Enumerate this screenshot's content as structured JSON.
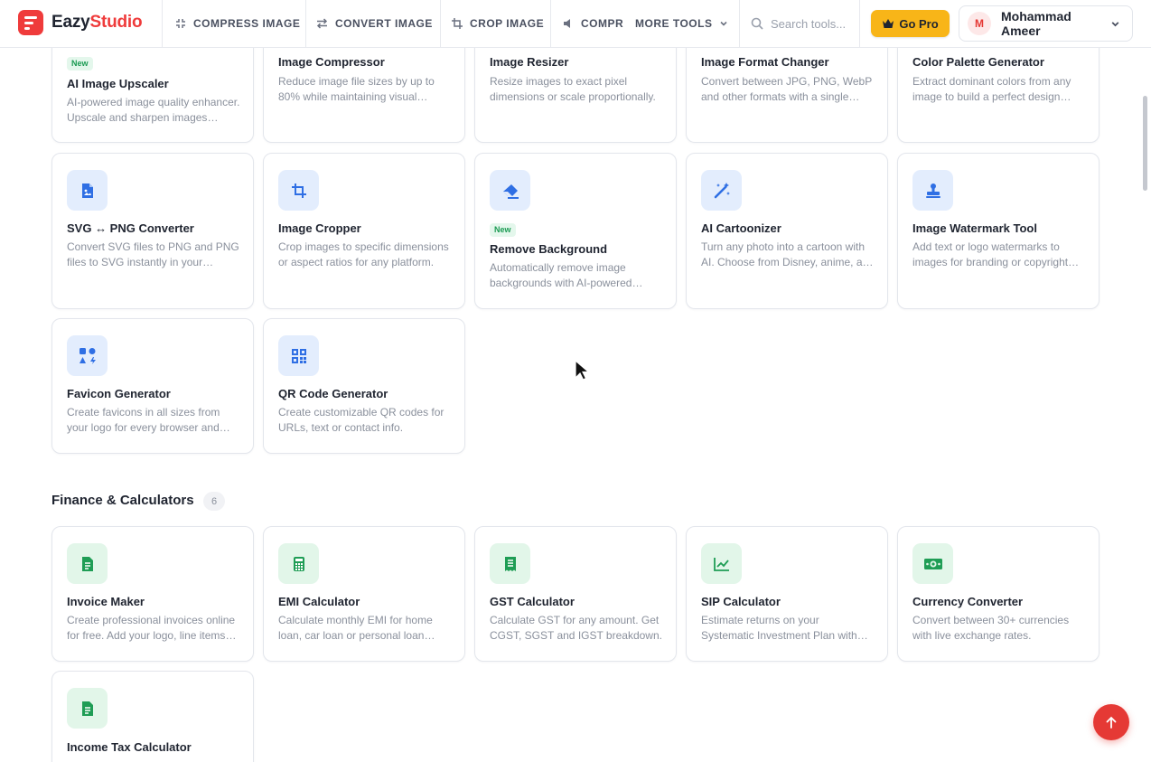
{
  "header": {
    "logo_part1": "Eazy",
    "logo_part2": "Studio",
    "nav": [
      {
        "label": "COMPRESS IMAGE",
        "icon": "compress-icon"
      },
      {
        "label": "CONVERT IMAGE",
        "icon": "convert-arrows-icon"
      },
      {
        "label": "CROP IMAGE",
        "icon": "crop-icon"
      },
      {
        "label": "COMPR",
        "icon": "audio-icon"
      }
    ],
    "more_tools": "MORE TOOLS",
    "search_placeholder": "Search tools...",
    "go_pro": "Go Pro",
    "user_initial": "M",
    "user_name": "Mohammad Ameer"
  },
  "image_tools": [
    {
      "title": "AI Image Upscaler",
      "badge": "New",
      "desc": "AI-powered image quality enhancer. Upscale and sharpen images instantly."
    },
    {
      "title": "Image Compressor",
      "desc": "Reduce image file sizes by up to 80% while maintaining visual quality."
    },
    {
      "title": "Image Resizer",
      "desc": "Resize images to exact pixel dimensions or scale proportionally."
    },
    {
      "title": "Image Format Changer",
      "desc": "Convert between JPG, PNG, WebP and other formats with a single click."
    },
    {
      "title": "Color Palette Generator",
      "desc": "Extract dominant colors from any image to build a perfect design palette."
    },
    {
      "title": "SVG ↔ PNG Converter",
      "icon": "file-image-icon",
      "desc": "Convert SVG files to PNG and PNG files to SVG instantly in your browser."
    },
    {
      "title": "Image Cropper",
      "icon": "crop-icon",
      "desc": "Crop images to specific dimensions or aspect ratios for any platform."
    },
    {
      "title": "Remove Background",
      "icon": "eraser-icon",
      "badge": "New",
      "desc": "Automatically remove image backgrounds with AI-powered detection."
    },
    {
      "title": "AI Cartoonizer",
      "icon": "magic-wand-icon",
      "desc": "Turn any photo into a cartoon with AI. Choose from Disney, anime, and more."
    },
    {
      "title": "Image Watermark Tool",
      "icon": "stamp-icon",
      "desc": "Add text or logo watermarks to images for branding or copyright protection."
    },
    {
      "title": "Favicon Generator",
      "icon": "favicon-shapes-icon",
      "desc": "Create favicons in all sizes from your logo for every browser and device."
    },
    {
      "title": "QR Code Generator",
      "icon": "qr-code-icon",
      "desc": "Create customizable QR codes for URLs, text or contact info."
    }
  ],
  "finance_section": {
    "title": "Finance & Calculators",
    "count": "6",
    "tools": [
      {
        "title": "Invoice Maker",
        "icon": "invoice-icon",
        "desc": "Create professional invoices online for free. Add your logo, line items and more."
      },
      {
        "title": "EMI Calculator",
        "icon": "calculator-icon",
        "desc": "Calculate monthly EMI for home loan, car loan or personal loan instantly."
      },
      {
        "title": "GST Calculator",
        "icon": "receipt-icon",
        "desc": "Calculate GST for any amount. Get CGST, SGST and IGST breakdown."
      },
      {
        "title": "SIP Calculator",
        "icon": "chart-line-icon",
        "desc": "Estimate returns on your Systematic Investment Plan with ease."
      },
      {
        "title": "Currency Converter",
        "icon": "money-bill-icon",
        "desc": "Convert between 30+ currencies with live exchange rates."
      },
      {
        "title": "Income Tax Calculator",
        "icon": "invoice-icon",
        "desc": ""
      }
    ]
  },
  "colors": {
    "brand": "#ef3b3b",
    "pro": "#f8b518",
    "blue_icon": "#2f6fe4",
    "green_icon": "#1f9d55"
  }
}
